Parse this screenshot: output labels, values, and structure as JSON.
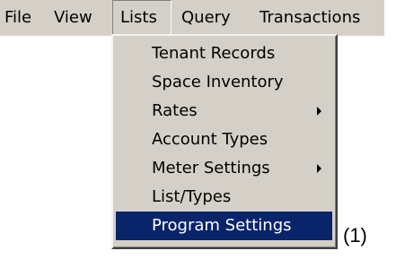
{
  "menubar": {
    "items": [
      {
        "label": "File"
      },
      {
        "label": "View"
      },
      {
        "label": "Lists"
      },
      {
        "label": "Query"
      },
      {
        "label": "Transactions"
      }
    ]
  },
  "dropdown": {
    "items": [
      {
        "label": "Tenant Records",
        "has_submenu": false
      },
      {
        "label": "Space Inventory",
        "has_submenu": false
      },
      {
        "label": "Rates",
        "has_submenu": true
      },
      {
        "label": "Account Types",
        "has_submenu": false
      },
      {
        "label": "Meter Settings",
        "has_submenu": true
      },
      {
        "label": "List/Types",
        "has_submenu": false
      },
      {
        "label": "Program Settings",
        "has_submenu": false,
        "highlighted": true
      }
    ]
  },
  "annotation": {
    "label": "(1)"
  },
  "colors": {
    "menu_background": "#d4d0c8",
    "highlight": "#0a246a",
    "highlight_text": "#ffffff"
  }
}
